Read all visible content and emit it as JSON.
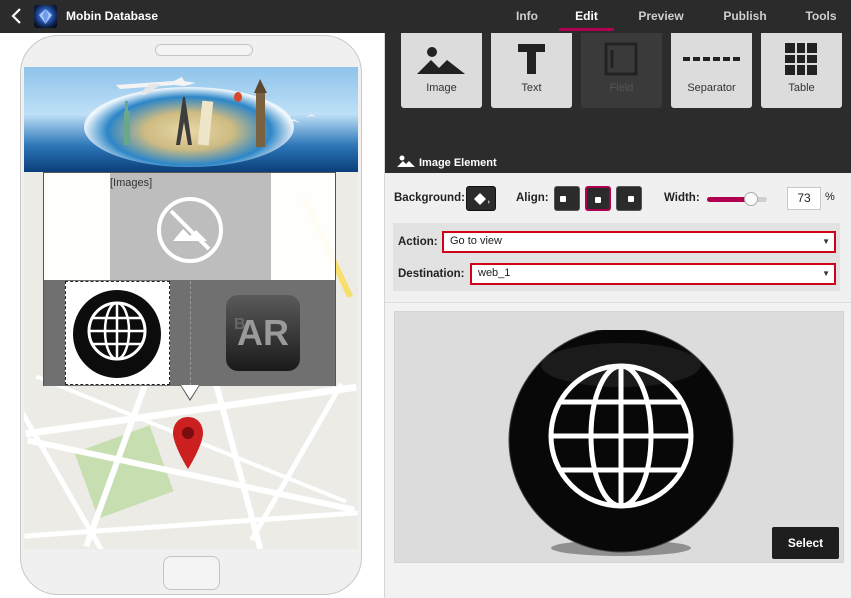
{
  "header": {
    "back_icon": "chevron-left-icon",
    "app_icon": "gem-logo-icon",
    "app_title": "Mobin Database",
    "tabs": [
      {
        "label": "Info"
      },
      {
        "label": "Edit",
        "active": true
      },
      {
        "label": "Preview"
      },
      {
        "label": "Publish"
      },
      {
        "label": "Tools"
      }
    ],
    "accent_color": "#b0004f"
  },
  "phone": {
    "component_label": "[Images]",
    "images": [
      "globe-icon",
      "bar-logo"
    ],
    "ar_logo": {
      "letters_small": "B",
      "letters": "AR"
    }
  },
  "toolbox": {
    "items": [
      {
        "label": "Image",
        "icon": "image-icon",
        "enabled": true
      },
      {
        "label": "Text",
        "icon": "text-icon",
        "enabled": true
      },
      {
        "label": "Field",
        "icon": "field-icon",
        "enabled": false
      },
      {
        "label": "Separator",
        "icon": "separator-icon",
        "enabled": true
      },
      {
        "label": "Table",
        "icon": "table-icon",
        "enabled": true
      }
    ],
    "section_title": "Image Element"
  },
  "properties": {
    "background_label": "Background:",
    "align_label": "Align:",
    "align_options": [
      "left",
      "center",
      "right"
    ],
    "align_selected": "center",
    "width_label": "Width:",
    "width_value": "73",
    "width_unit": "%",
    "width_fraction": 0.73,
    "action_label": "Action:",
    "action_value": "Go to view",
    "destination_label": "Destination:",
    "destination_value": "web_1"
  },
  "preview": {
    "image": "globe-icon",
    "select_label": "Select"
  }
}
